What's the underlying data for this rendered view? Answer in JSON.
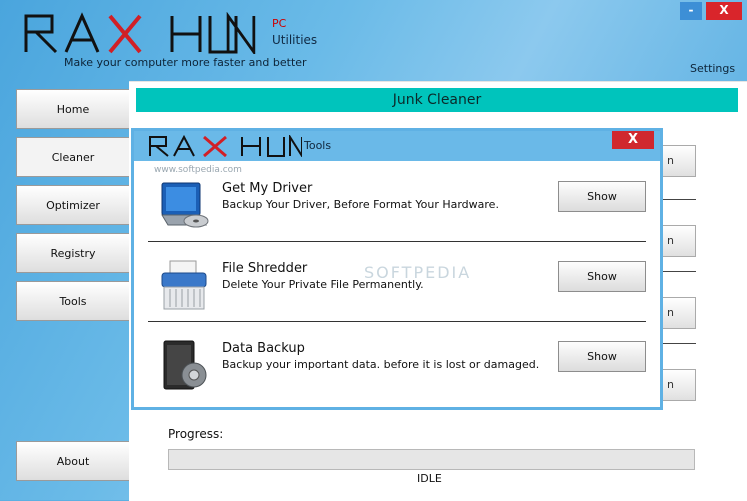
{
  "brand": {
    "logo": "RAXHUN",
    "sub_pc": "PC",
    "sub_utilities": "Utilities",
    "tagline": "Make your computer more faster and better",
    "colors": {
      "logo_dark": "#111111",
      "logo_accent": "#d11f26"
    }
  },
  "window": {
    "minimize_label": "-",
    "close_label": "X",
    "settings_label": "Settings"
  },
  "nav": {
    "items": [
      {
        "label": "Home"
      },
      {
        "label": "Cleaner"
      },
      {
        "label": "Optimizer"
      },
      {
        "label": "Registry"
      },
      {
        "label": "Tools"
      }
    ],
    "about_label": "About",
    "active": "Cleaner"
  },
  "main": {
    "title": "Junk Cleaner",
    "title_color": "#00c4bc",
    "hidden_button_fragment": "n",
    "progress_label": "Progress:",
    "progress_value": 0,
    "status": "IDLE"
  },
  "dialog": {
    "logo": "RAXHUN",
    "title": "Tools",
    "close_label": "X",
    "watermark": "www.softpedia.com",
    "watermark_big": "SOFTPEDIA",
    "tools": [
      {
        "title": "Get My Driver",
        "description": "Backup Your Driver, Before Format Your Hardware.",
        "button": "Show",
        "icon": "driver-icon"
      },
      {
        "title": "File Shredder",
        "description": "Delete Your Private File Permanently.",
        "button": "Show",
        "icon": "shredder-icon"
      },
      {
        "title": "Data Backup",
        "description": "Backup your important data. before it is lost or damaged.",
        "button": "Show",
        "icon": "backup-icon"
      }
    ]
  }
}
